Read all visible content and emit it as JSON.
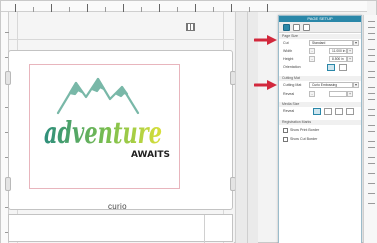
{
  "brand_mark": "curio",
  "artwork": {
    "main_word": "adventure",
    "sub_word": "AWAITS",
    "mountain_color": "#79b8a8",
    "word_gradient": [
      "#2e8f7c",
      "#7cbf4e",
      "#d9df3a"
    ],
    "sub_word_color": "#1f1f1f"
  },
  "panel": {
    "title": "PAGE SETUP",
    "toolbar_icons": [
      "page-settings-icon",
      "cut-settings-icon",
      "print-settings-icon"
    ],
    "page_section": "Page Size",
    "rows": [
      {
        "label": "Cut",
        "value": "Standard"
      },
      {
        "label": "Width",
        "value": "11.000 in"
      },
      {
        "label": "Height",
        "value": "8.500 in"
      },
      {
        "label": "Orientation",
        "value": ""
      }
    ],
    "cutting_section": "Cutting Mat",
    "cutting_rows": [
      {
        "label": "Cutting Mat",
        "value": "Curio Embossing"
      },
      {
        "label": "Reveal",
        "value": ""
      }
    ],
    "media_section": "Media Size",
    "media_label": "Reveal",
    "registration_section": "Registration Marks",
    "checkboxes": [
      {
        "label": "Show Print Border",
        "checked": false
      },
      {
        "label": "Show Cut Border",
        "checked": false
      }
    ]
  },
  "annotations": {
    "arrow_color": "#d2283c"
  }
}
